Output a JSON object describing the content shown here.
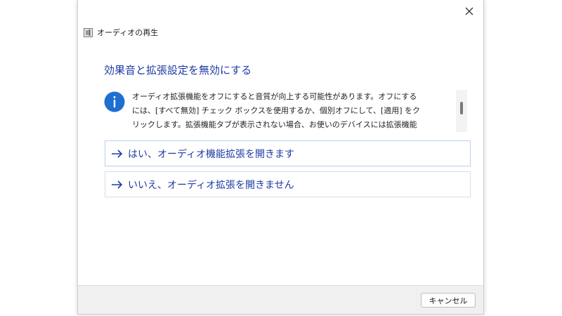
{
  "window": {
    "title": "オーディオの再生",
    "close_icon": "close-icon",
    "app_icon": "speaker-icon"
  },
  "content": {
    "heading": "効果音と拡張設定を無効にする",
    "info_icon": "info-icon",
    "info_lines": [
      "オーディオ拡張機能をオフにすると音質が向上する可能性があります。オフにする",
      "には、[すべて無効] チェック ボックスを使用するか、個別オフにして、[適用] をク",
      "リックします。拡張機能タブが表示されない場合、お使いのデバイスには拡張機能"
    ]
  },
  "options": [
    {
      "label": "はい、オーディオ機能拡張を開きます",
      "icon": "arrow-right-icon"
    },
    {
      "label": "いいえ、オーディオ拡張を開きません",
      "icon": "arrow-right-icon"
    }
  ],
  "footer": {
    "cancel_label": "キャンセル"
  },
  "colors": {
    "accent": "#1d3ba3",
    "info_badge": "#1e6fd0",
    "footer_bg": "#f0f0f0"
  }
}
